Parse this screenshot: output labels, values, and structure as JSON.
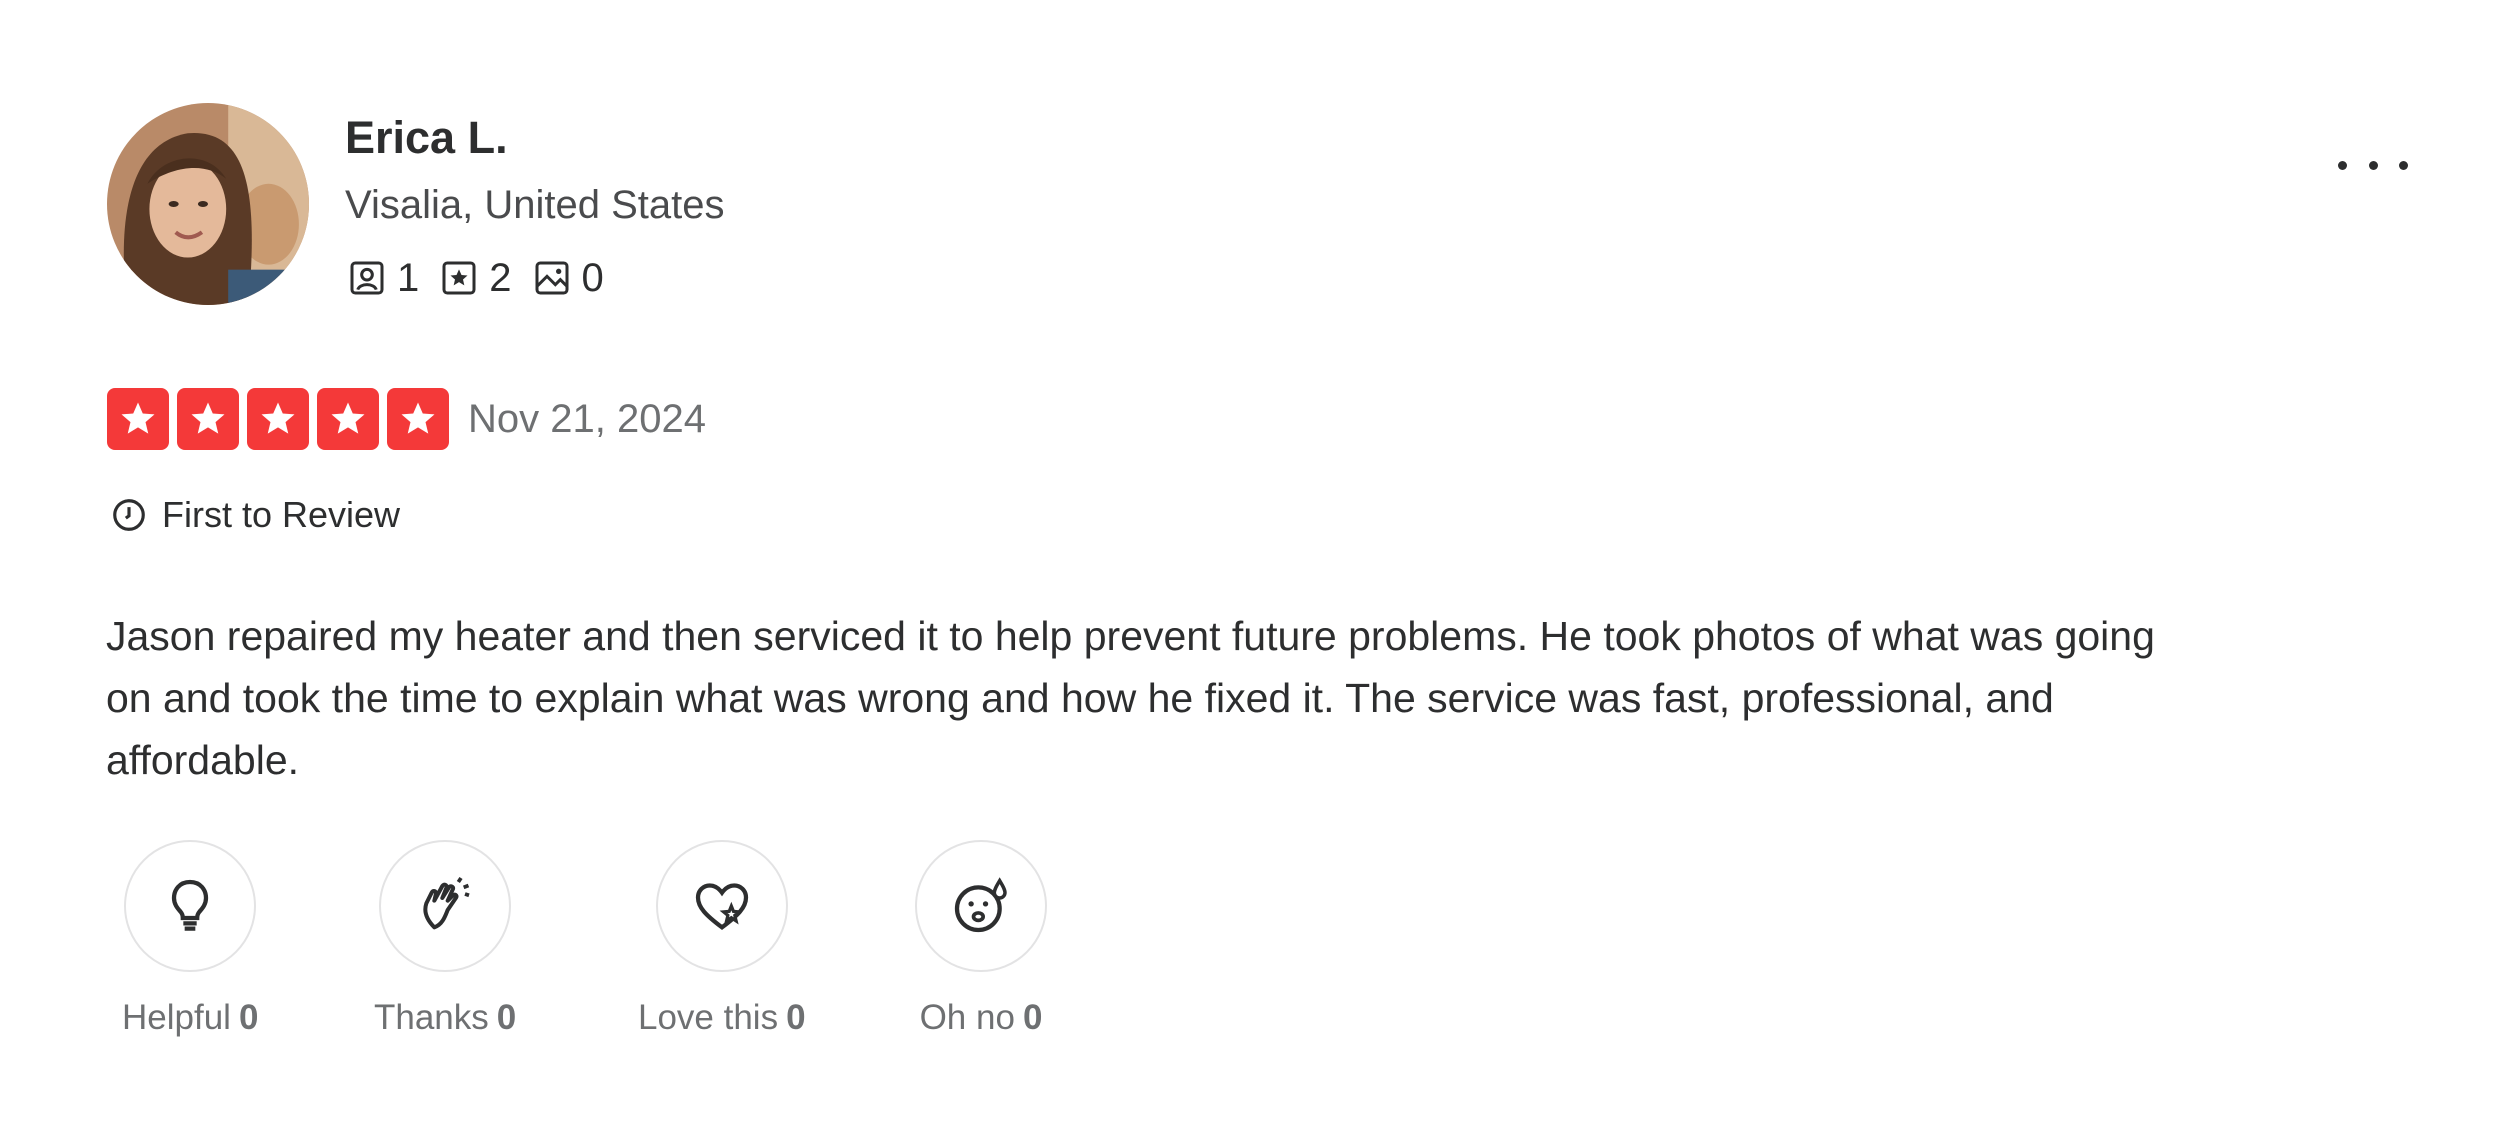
{
  "reviewer": {
    "name": "Erica L.",
    "location": "Visalia, United States",
    "stats": [
      {
        "icon": "friends-icon",
        "value": "1"
      },
      {
        "icon": "reviews-icon",
        "value": "2"
      },
      {
        "icon": "photos-icon",
        "value": "0"
      }
    ]
  },
  "review": {
    "rating": 5,
    "rating_max": 5,
    "date": "Nov 21, 2024",
    "badge": "First to Review",
    "text": "Jason repaired my heater and then serviced it to help prevent future problems. He took photos of what was going on and took the time to explain what was wrong and how he fixed it. The service was fast, professional, and affordable."
  },
  "reactions": [
    {
      "label": "Helpful",
      "count": "0",
      "icon": "lightbulb-icon"
    },
    {
      "label": "Thanks",
      "count": "0",
      "icon": "clapping-hands-icon"
    },
    {
      "label": "Love this",
      "count": "0",
      "icon": "heart-icon"
    },
    {
      "label": "Oh no",
      "count": "0",
      "icon": "surprised-face-icon"
    }
  ],
  "colors": {
    "star": "#f43939",
    "text": "#2d2e2f",
    "muted": "#6e7072"
  }
}
